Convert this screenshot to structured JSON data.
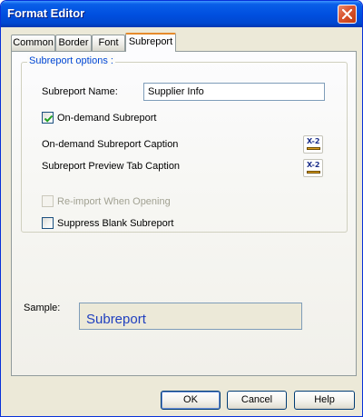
{
  "window": {
    "title": "Format Editor"
  },
  "tabs": [
    {
      "label": "Common"
    },
    {
      "label": "Border"
    },
    {
      "label": "Font"
    },
    {
      "label": "Subreport",
      "active": true
    }
  ],
  "group": {
    "legend": "Subreport options :",
    "subreport_name_label": "Subreport Name:",
    "subreport_name_value": "Supplier Info",
    "on_demand_label": "On-demand Subreport",
    "on_demand_checked": true,
    "on_demand_caption_label": "On-demand Subreport Caption",
    "preview_tab_caption_label": "Subreport Preview Tab Caption",
    "reimport_label": "Re-import When Opening",
    "reimport_checked": false,
    "reimport_enabled": false,
    "suppress_blank_label": "Suppress Blank Subreport",
    "suppress_blank_checked": false,
    "formula_button_glyph": "X-2"
  },
  "sample": {
    "label": "Sample:",
    "text": "Subreport"
  },
  "buttons": {
    "ok": "OK",
    "cancel": "Cancel",
    "help": "Help"
  },
  "icons": {
    "close": "close-icon",
    "checkmark": "checkmark-icon",
    "formula": "formula-x2-icon"
  },
  "colors": {
    "titlebar": "#0050e0",
    "legend_text": "#0046d5",
    "sample_text": "#1f3fbf",
    "active_tab_accent": "#e68b2c"
  }
}
